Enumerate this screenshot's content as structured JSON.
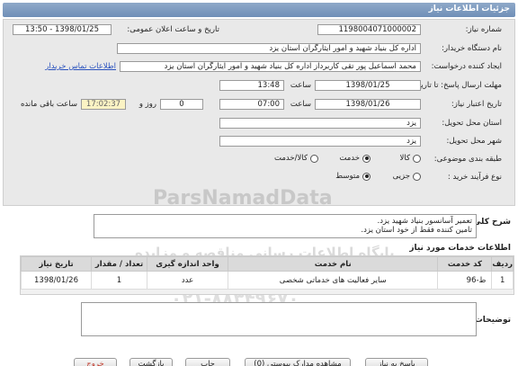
{
  "title": "جزئیات اطلاعات نیاز",
  "form": {
    "need_number": {
      "label": "شماره نیاز:",
      "value": "1198004071000002"
    },
    "announce_datetime": {
      "label": "تاریخ و ساعت اعلان عمومی:",
      "value": "1398/01/25 - 13:50"
    },
    "buyer_org": {
      "label": "نام دستگاه خریدار:",
      "value": "اداره کل بنیاد شهید و امور ایثارگران استان یزد"
    },
    "requester": {
      "label": "ایجاد کننده درخواست:",
      "value": "محمد اسماعیل پور تقی کاربرداز اداره کل بنیاد شهید و امور ایثارگران استان یزد",
      "contact_link": "اطلاعات تماس خریدار"
    },
    "reply_deadline": {
      "label": "مهلت ارسال پاسخ: تا تاریخ:",
      "date": "1398/01/25",
      "time_label": "ساعت",
      "time": "13:48"
    },
    "validity": {
      "label": "تاریخ اعتبار نیاز:",
      "date": "1398/01/26",
      "time_label": "ساعت",
      "time": "07:00",
      "days": "0",
      "days_label": "روز و",
      "remaining": "17:02:37",
      "remaining_label": "ساعت باقی مانده"
    },
    "delivery_province": {
      "label": "استان محل تحویل:",
      "value": "یزد"
    },
    "delivery_city": {
      "label": "شهر محل تحویل:",
      "value": "یزد"
    },
    "category": {
      "label": "طبقه بندی موضوعی:",
      "options": [
        "کالا",
        "خدمت",
        "کالا/خدمت"
      ],
      "selected": "خدمت"
    },
    "process": {
      "label": "نوع فرآیند خرید :",
      "options": [
        "جزیی",
        "متوسط"
      ],
      "selected": "متوسط"
    }
  },
  "description": {
    "label": "شرح کلی نیاز:",
    "line1": "تعمیر آسانسور بنیاد شهید یزد.",
    "line2": "تامین کننده فقط از خود استان یزد."
  },
  "services": {
    "title": "اطلاعات خدمات مورد نیاز",
    "headers": [
      "ردیف",
      "کد خدمت",
      "نام خدمت",
      "واحد اندازه گیری",
      "تعداد / مقدار",
      "تاریخ نیاز"
    ],
    "rows": [
      [
        "1",
        "ط-96",
        "سایر فعالیت های خدماتی شخصی",
        "عدد",
        "1",
        "1398/01/26"
      ]
    ]
  },
  "buyer_notes": {
    "label": "توضیحات خریدار:",
    "value": ""
  },
  "buttons": {
    "reply": "پاسخ به نیاز",
    "view_docs": "مشاهده مدارک پیوستی (0)",
    "print": "چاپ",
    "back": "بازگشت",
    "exit": "خروج"
  },
  "watermarks": {
    "brand": "ParsNamadData",
    "tagline": "پایگاه اطلاعات رسانی مناقصه و مزایده",
    "phone": "۰۲۱-۸۸۳۴۹۶۷۰"
  }
}
